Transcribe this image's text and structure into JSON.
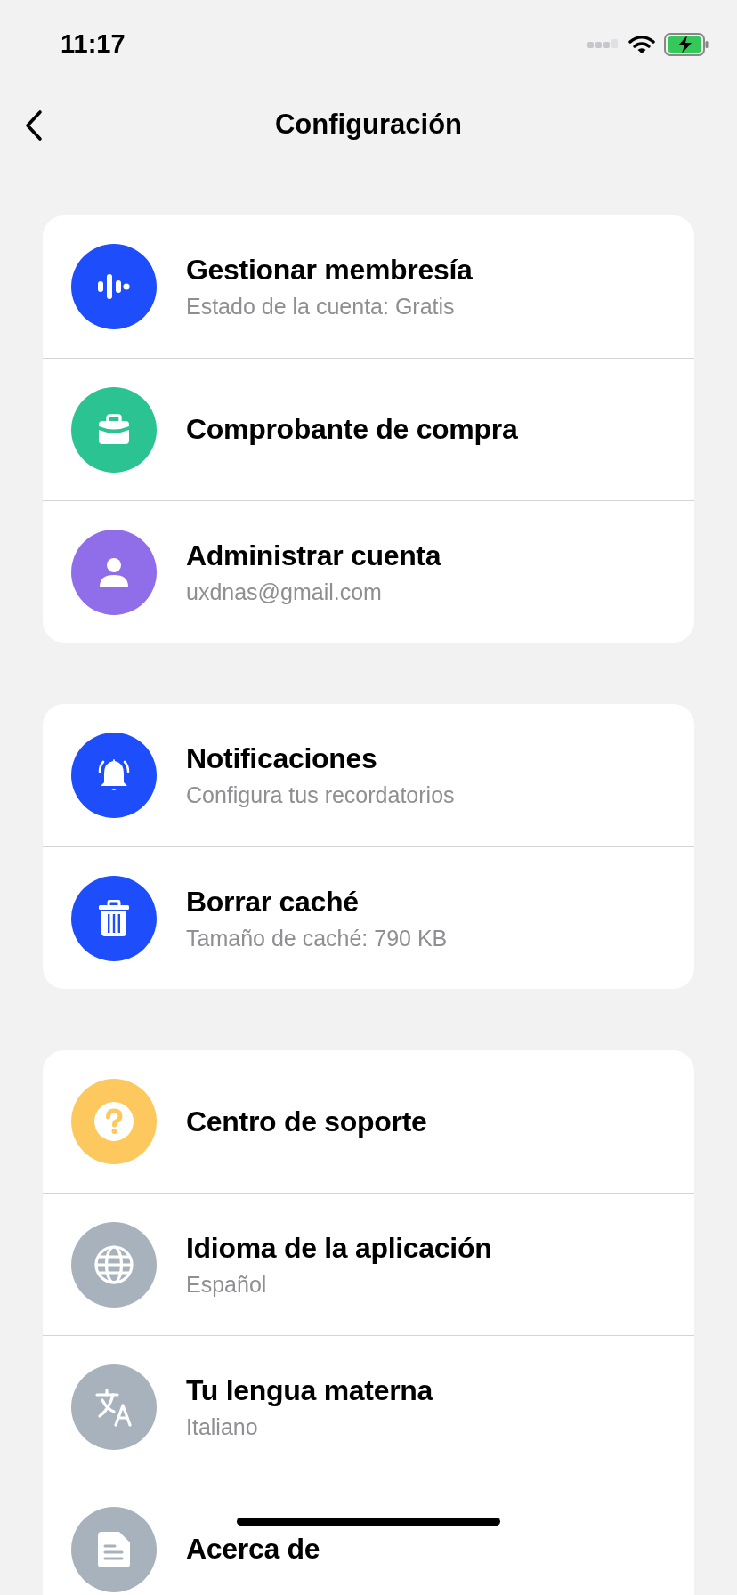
{
  "status_bar": {
    "time": "11:17"
  },
  "nav": {
    "title": "Configuración"
  },
  "sections": [
    {
      "items": [
        {
          "kind": "waveform",
          "color": "#1e4dfb",
          "title": "Gestionar membresía",
          "subtitle": "Estado de la cuenta: Gratis"
        },
        {
          "kind": "briefcase",
          "color": "#2cc392",
          "title": "Comprobante de compra"
        },
        {
          "kind": "person",
          "color": "#906eea",
          "title": "Administrar cuenta",
          "subtitle": "uxdnas@gmail.com"
        }
      ]
    },
    {
      "items": [
        {
          "kind": "bell",
          "color": "#1e4dfb",
          "title": "Notificaciones",
          "subtitle": "Configura tus recordatorios"
        },
        {
          "kind": "trash",
          "color": "#1e4dfb",
          "title": "Borrar caché",
          "subtitle": "Tamaño de caché: 790 KB"
        }
      ]
    },
    {
      "items": [
        {
          "kind": "question",
          "color": "#fdc85d",
          "title": "Centro de soporte"
        },
        {
          "kind": "globe",
          "color": "#a8b2bd",
          "title": "Idioma de la aplicación",
          "subtitle": "Español"
        },
        {
          "kind": "translate",
          "color": "#a8b2bd",
          "title": "Tu lengua materna",
          "subtitle": "Italiano"
        },
        {
          "kind": "document",
          "color": "#a8b2bd",
          "title": "Acerca de"
        }
      ]
    }
  ]
}
